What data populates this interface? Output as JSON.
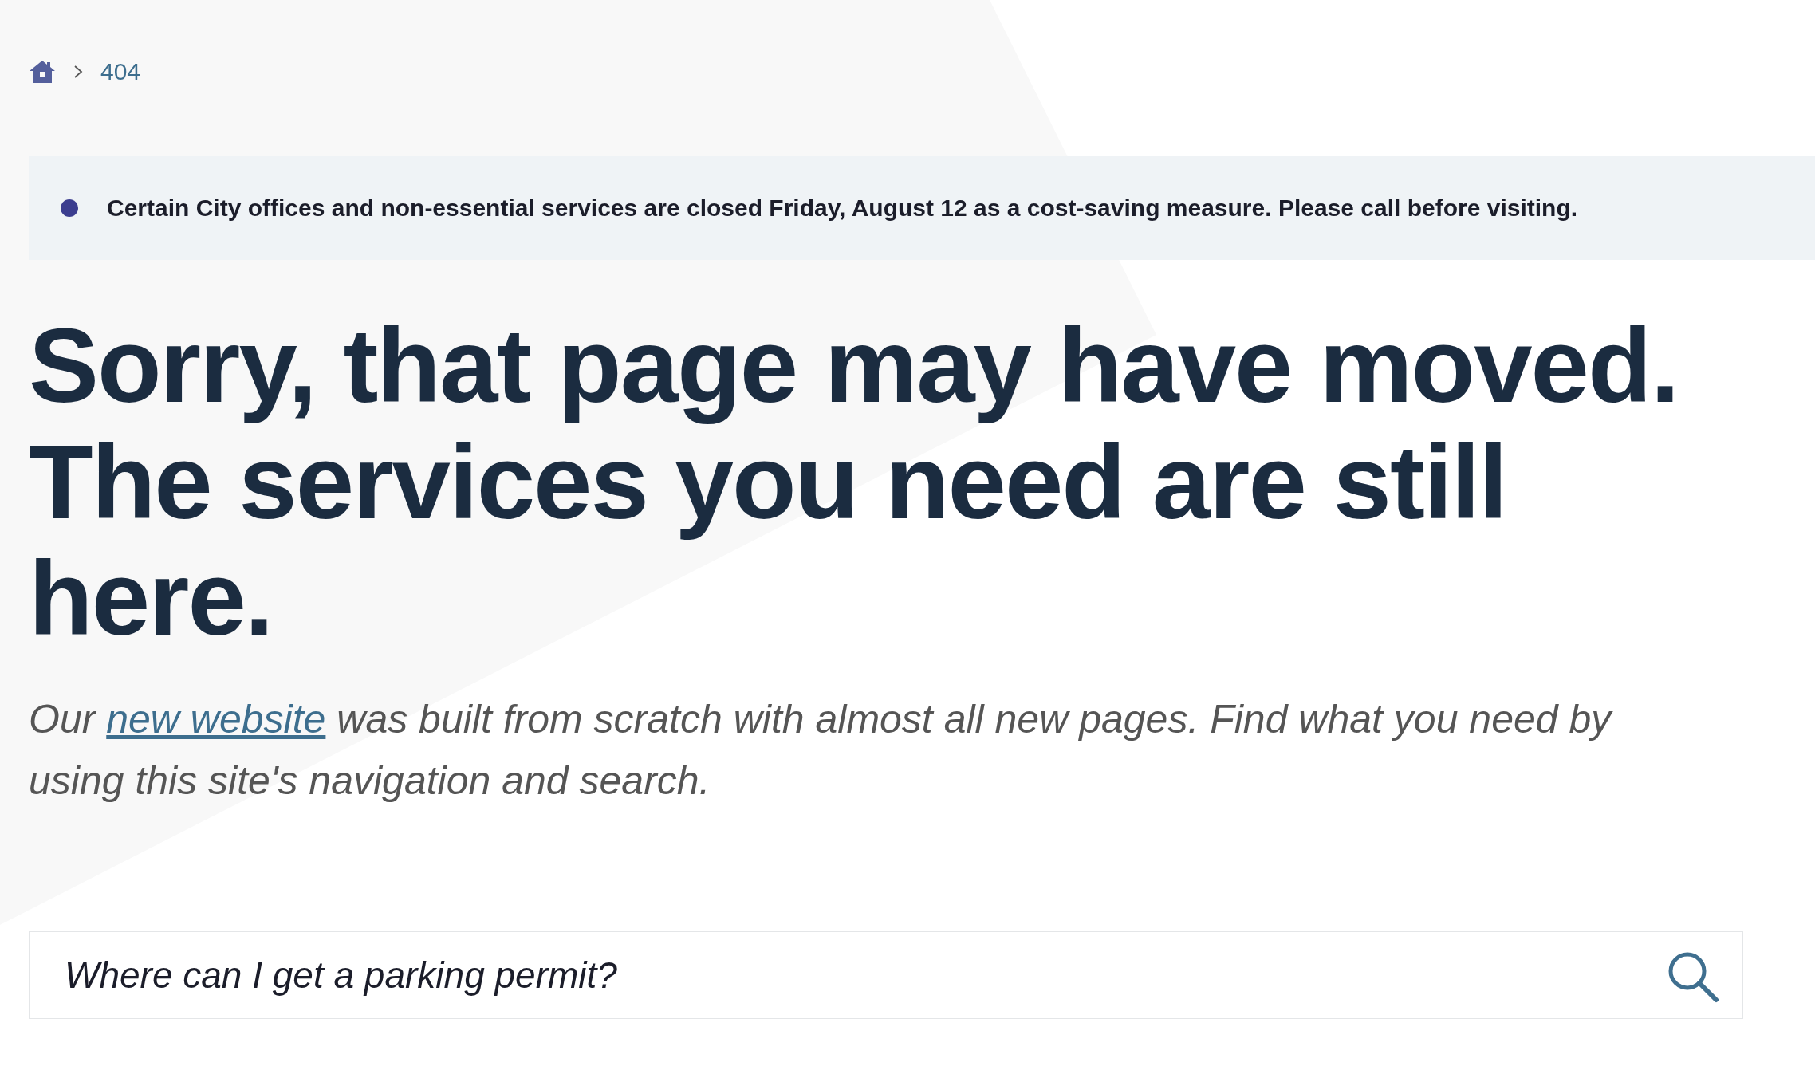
{
  "breadcrumb": {
    "items": [
      {
        "label": "404"
      }
    ]
  },
  "alert": {
    "text": "Certain City offices and non-essential services are closed Friday, August 12 as a cost-saving measure. Please call before visiting."
  },
  "heading": "Sorry, that page may have moved. The services you need are still here.",
  "intro": {
    "before": "Our",
    "link": "new website",
    "after": "was built from scratch with almost all new pages. Find what you need by using this site's navigation and search."
  },
  "search": {
    "placeholder": "Where can I get a parking permit?"
  }
}
